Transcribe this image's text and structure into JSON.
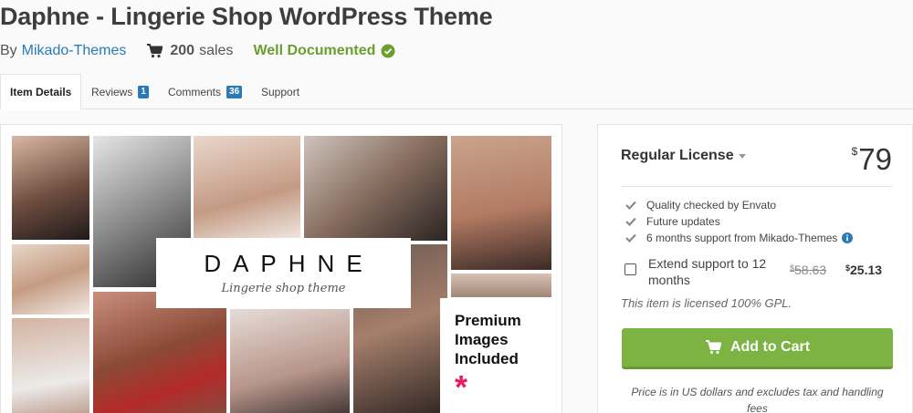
{
  "item": {
    "title": "Daphne - Lingerie Shop WordPress Theme",
    "by_label": "By",
    "author": "Mikado-Themes",
    "sales_count": "200",
    "sales_label": "sales",
    "documented": "Well Documented"
  },
  "tabs": [
    {
      "label": "Item Details",
      "active": true
    },
    {
      "label": "Reviews",
      "badge": "1"
    },
    {
      "label": "Comments",
      "badge": "36"
    },
    {
      "label": "Support"
    }
  ],
  "preview": {
    "brand": "DAPHNE",
    "tagline": "Lingerie shop theme",
    "premium_lines": [
      "Premium",
      "Images",
      "Included"
    ],
    "star": "*"
  },
  "license": {
    "type": "Regular License",
    "currency": "$",
    "price": "79",
    "features": [
      "Quality checked by Envato",
      "Future updates",
      "6 months support from Mikado-Themes"
    ],
    "extend_label": "Extend support to 12 months",
    "extend_old_price": "58.63",
    "extend_new_price": "25.13",
    "gpl_note": "This item is licensed 100% GPL.",
    "cart_button": "Add to Cart",
    "price_note": "Price is in US dollars and excludes tax and handling fees"
  },
  "colors": {
    "link": "#2a7ab8",
    "documented": "#6a9f2f",
    "cart_button": "#7cb342",
    "star": "#e61c63"
  }
}
